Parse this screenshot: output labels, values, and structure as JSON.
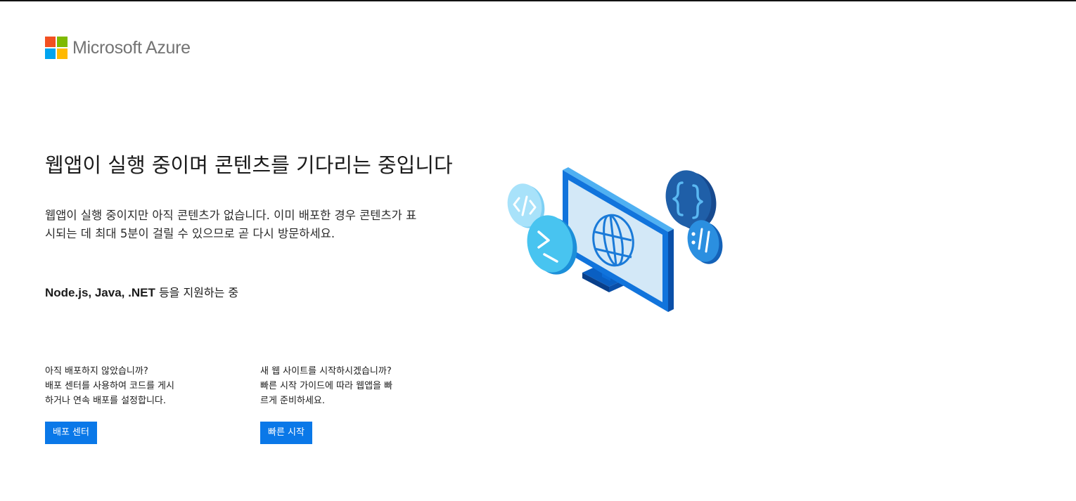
{
  "brand": {
    "name": "Microsoft Azure",
    "logo_colors": [
      "#f25022",
      "#7fba00",
      "#00a4ef",
      "#ffb900"
    ]
  },
  "headline": "웹앱이 실행 중이며 콘텐츠를 기다리는 중입니다",
  "lead": "웹앱이 실행 중이지만 아직 콘텐츠가 없습니다. 이미 배포한 경우 콘텐츠가 표시되는 데 최대 5분이 걸릴 수 있으므로 곧 다시 방문하세요.",
  "support": {
    "tech": "Node.js, Java, .NET",
    "suffix": "등을 지원하는 중"
  },
  "deploy": {
    "line1": "아직 배포하지 않았습니까?",
    "line2": "배포 센터를 사용하여 코드를 게시",
    "line3": "하거나 연속 배포를 설정합니다.",
    "button": "배포 센터"
  },
  "quickstart": {
    "line1": "새 웹 사이트를 시작하시겠습니까?",
    "line2": "빠른 시작 가이드에 따라 웹앱을 빠",
    "line3": "르게 준비하세요.",
    "button": "빠른 시작"
  },
  "illustration": {
    "icons": [
      "monitor-globe-icon",
      "code-tag-icon",
      "terminal-prompt-icon",
      "curly-braces-icon",
      "colon-slash-icon"
    ],
    "accent": "#0a78e8"
  }
}
